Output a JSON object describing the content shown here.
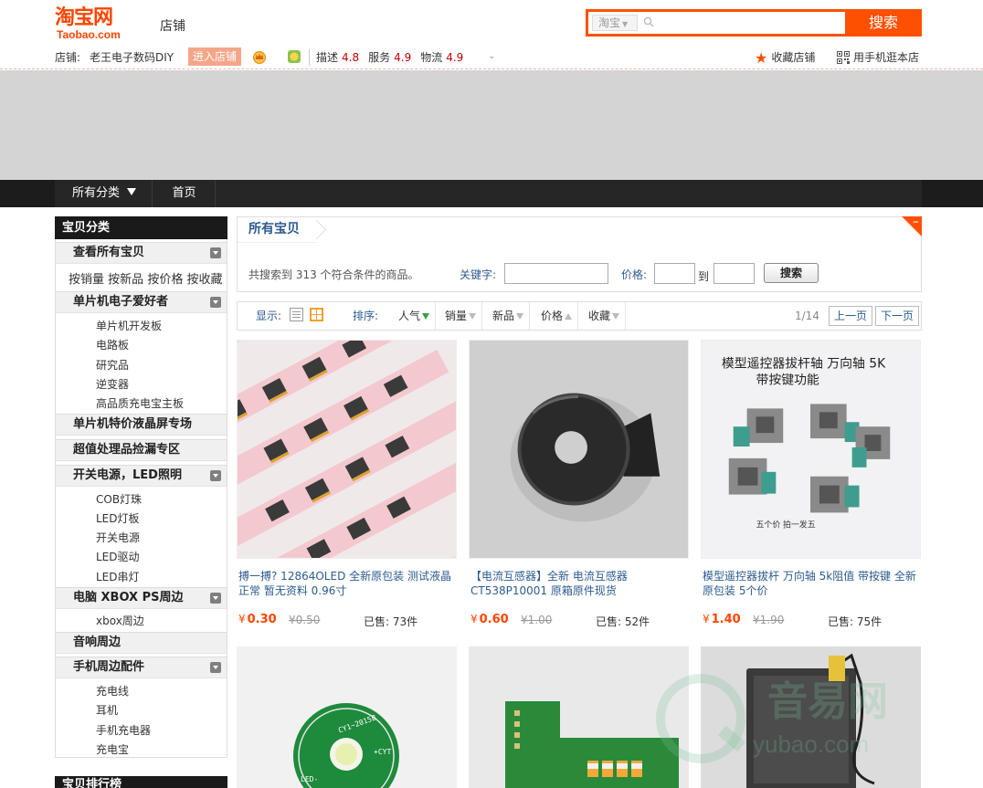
{
  "header": {
    "logo_cn": "淘宝网",
    "logo_en": "Taobao.com",
    "shop_word": "店铺",
    "search_scope": "淘宝",
    "search_placeholder": "",
    "search_button": "搜索"
  },
  "shopbar": {
    "label": "店铺:",
    "shop_name": "老王电子数码DIY",
    "enter_button": "进入店铺",
    "ratings": [
      {
        "label": "描述",
        "score": "4.8"
      },
      {
        "label": "服务",
        "score": "4.9"
      },
      {
        "label": "物流",
        "score": "4.9"
      }
    ],
    "favorite": "收藏店铺",
    "mobile": "用手机逛本店",
    "accent_color": "#ff5000"
  },
  "nav": {
    "all_categories": "所有分类",
    "home": "首页"
  },
  "sidebar": {
    "title": "宝贝分类",
    "view_all": "查看所有宝贝",
    "sort_links": [
      "按销量",
      "按新品",
      "按价格",
      "按收藏"
    ],
    "categories": [
      {
        "name": "单片机电子爱好者",
        "subs": [
          "单片机开发板",
          "电路板",
          "研究品",
          "逆变器",
          "高品质充电宝主板"
        ]
      },
      {
        "name": "单片机特价液晶屏专场",
        "subs": []
      },
      {
        "name": "超值处理品捡漏专区",
        "subs": []
      },
      {
        "name": "开关电源，LED照明",
        "subs": [
          "COB灯珠",
          "LED灯板",
          "开关电源",
          "LED驱动",
          "LED串灯"
        ]
      },
      {
        "name": "电脑 XBOX PS周边",
        "subs": [
          "xbox周边"
        ]
      },
      {
        "name": "音响周边",
        "subs": []
      },
      {
        "name": "手机周边配件",
        "subs": [
          "充电线",
          "耳机",
          "手机充电器",
          "充电宝"
        ]
      }
    ],
    "ranking_title": "宝贝排行榜"
  },
  "main": {
    "tab": "所有宝贝",
    "result_text": "共搜索到 313 个符合条件的商品。",
    "keyword_label": "关键字:",
    "price_label": "价格:",
    "to_label": "到",
    "search_button": "搜索",
    "display_label": "显示:",
    "sort_label": "排序:",
    "sorts": [
      "人气",
      "销量",
      "新品",
      "价格",
      "收藏"
    ],
    "page_info": "1/14",
    "prev": "上一页",
    "next": "下一页"
  },
  "products": [
    {
      "title": "搏一搏? 12864OLED 全新原包装 测试液晶 正常 暂无资料 0.96寸",
      "currency": "¥",
      "price": "0.30",
      "orig": "¥0.50",
      "sold": "已售: 73件"
    },
    {
      "title": "【电流互感器】全新 电流互感器 CT538P10001 原箱原件现货",
      "currency": "¥",
      "price": "0.60",
      "orig": "¥1.00",
      "sold": "已售: 52件"
    },
    {
      "title": "模型遥控器拔杆 万向轴 5k阻值 带按键 全新原包装 5个价",
      "currency": "¥",
      "price": "1.40",
      "orig": "¥1.90",
      "sold": "已售: 75件"
    }
  ],
  "product_image_text": {
    "p3_caption_top": "模型遥控器拔杆轴 万向轴 5K",
    "p3_caption_mid": "带按键功能",
    "p3_caption_bottom": "五个价 拍一发五",
    "r2_board_label": "CY1~2015B",
    "r2_board_label2": "+CYT",
    "r2_board_led": "LED-"
  },
  "watermark": {
    "cn": "音易网",
    "en": "yubao.com"
  }
}
